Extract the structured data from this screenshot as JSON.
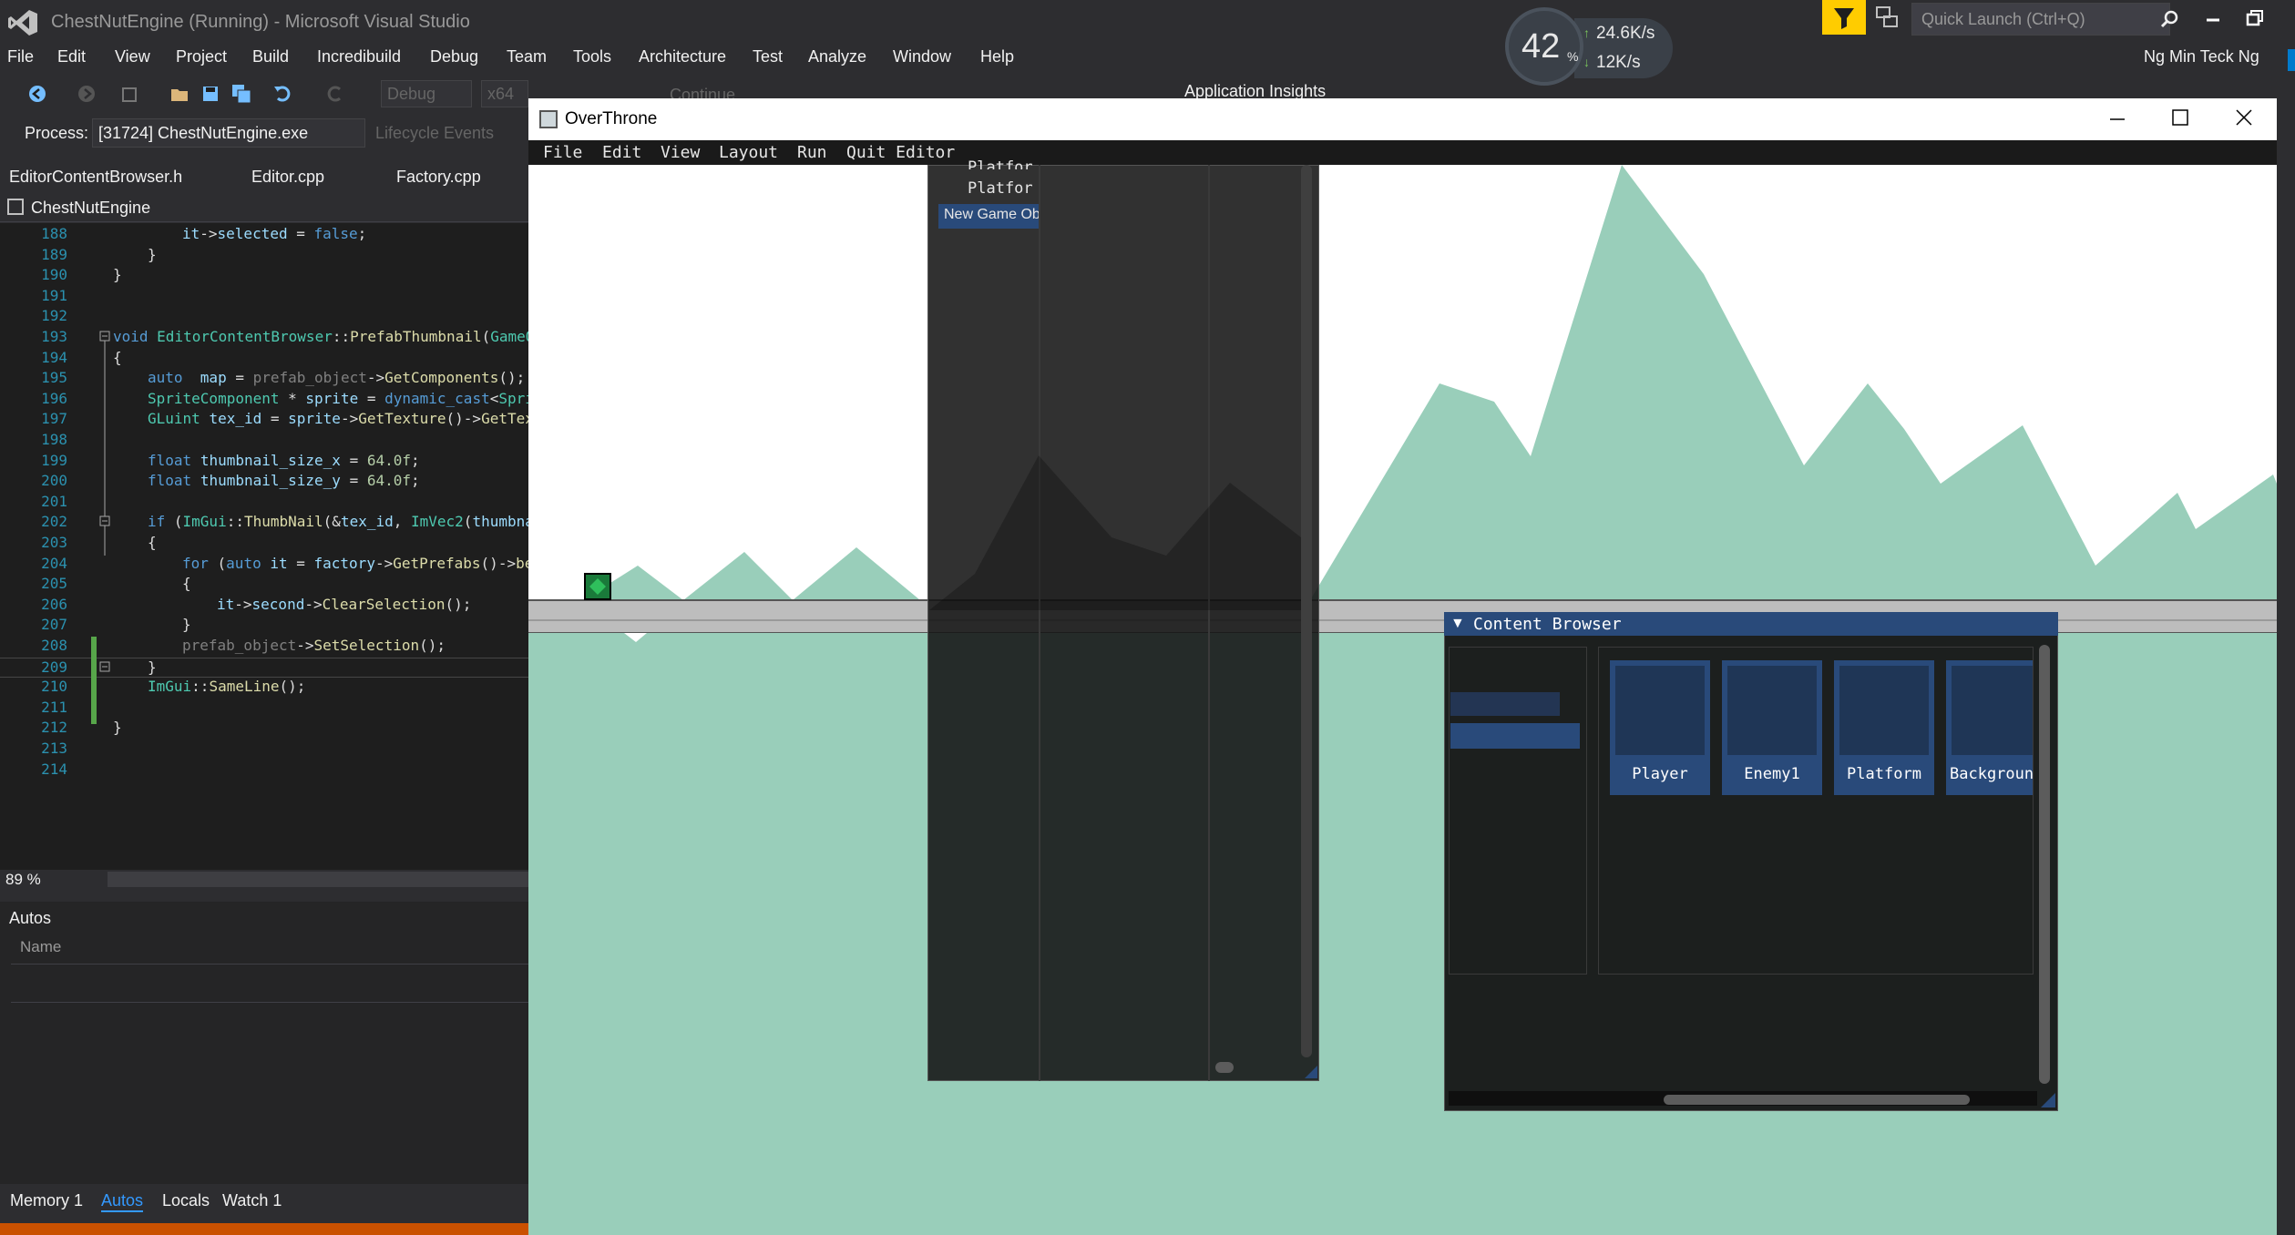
{
  "vs": {
    "title": "ChestNutEngine (Running) - Microsoft Visual Studio",
    "network": {
      "percent": "42",
      "percent_sign": "%",
      "up": "24.6K/s",
      "down": "12K/s"
    },
    "quick_launch_placeholder": "Quick Launch (Ctrl+Q)",
    "menus": [
      "File",
      "Edit",
      "View",
      "Project",
      "Build",
      "Incredibuild",
      "Debug",
      "Team",
      "Tools",
      "Architecture",
      "Test",
      "Analyze",
      "Window",
      "Help"
    ],
    "user": "Ng Min Teck Ng",
    "toolbar": {
      "config": "Debug",
      "platform": "x64",
      "continue": "Continue",
      "app_insights": "Application Insights"
    },
    "process": {
      "label": "Process:",
      "value": "[31724] ChestNutEngine.exe",
      "lifecycle": "Lifecycle Events"
    },
    "tabs": [
      "EditorContentBrowser.h",
      "Editor.cpp",
      "Factory.cpp"
    ],
    "nav_project": "ChestNutEngine",
    "zoom": "89 %",
    "autos": {
      "title": "Autos",
      "col_name": "Name"
    },
    "bottom_tabs": [
      "Memory 1",
      "Autos",
      "Locals",
      "Watch 1"
    ],
    "colors": {
      "accent": "#007acc",
      "status": "#ca5100",
      "imgui_blue": "#294a7a",
      "sky": "#ffffff",
      "ground": "#99ceba"
    }
  },
  "code": {
    "line_numbers": [
      "188",
      "189",
      "190",
      "191",
      "192",
      "193",
      "194",
      "195",
      "196",
      "197",
      "198",
      "199",
      "200",
      "201",
      "202",
      "203",
      "204",
      "205",
      "206",
      "207",
      "208",
      "209",
      "210",
      "211",
      "212",
      "213",
      "214"
    ]
  },
  "game": {
    "title": "OverThrone",
    "menus": [
      "File",
      "Edit",
      "View",
      "Layout",
      "Run",
      "Quit Editor"
    ],
    "hierarchy": {
      "item_1": "Platfor",
      "item_2": "Platfor",
      "new_game": "New Game Obj"
    },
    "content_browser": {
      "title": "Content Browser",
      "collapse_icon": "▼",
      "prefabs": [
        "Player",
        "Enemy1",
        "Platform",
        "Background"
      ]
    }
  }
}
